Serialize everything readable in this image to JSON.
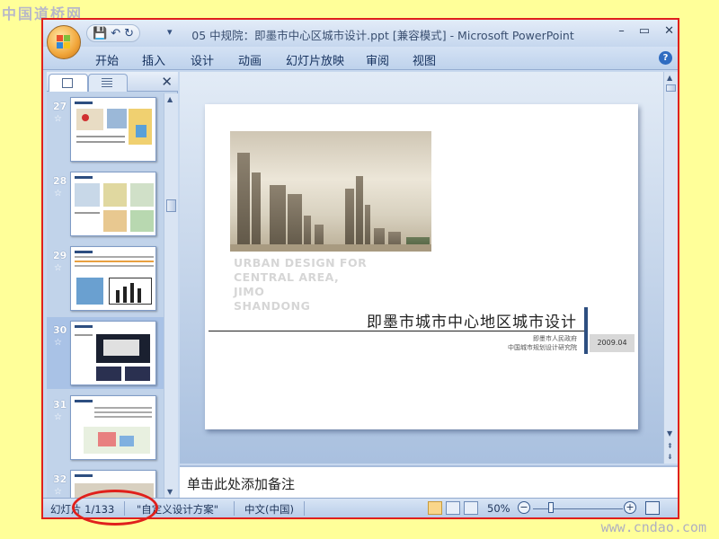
{
  "watermarks": {
    "top_left": "中国道桥网",
    "bottom_right": "www.cndao.com"
  },
  "window": {
    "title": "05 中规院：即墨市中心区城市设计.ppt [兼容模式] - Microsoft PowerPoint",
    "controls": [
      "–",
      "▭",
      "✕"
    ]
  },
  "quick_access": {
    "save": "💾",
    "undo": "↶",
    "redo": "↻",
    "more": "▾"
  },
  "ribbon": {
    "tabs": [
      "开始",
      "插入",
      "设计",
      "动画",
      "幻灯片放映",
      "审阅",
      "视图"
    ]
  },
  "thumbnails": [
    {
      "num": "27",
      "selected": false
    },
    {
      "num": "28",
      "selected": false
    },
    {
      "num": "29",
      "selected": false
    },
    {
      "num": "30",
      "selected": true
    },
    {
      "num": "31",
      "selected": false
    },
    {
      "num": "32",
      "selected": false
    }
  ],
  "slide": {
    "english_title": [
      "URBAN DESIGN FOR",
      "CENTRAL AREA,",
      "JIMO",
      "SHANDONG"
    ],
    "chinese_title": "即墨市城市中心地区城市设计",
    "org_line1": "即墨市人民政府",
    "org_line2": "中国城市规划设计研究院",
    "date": "2009.04"
  },
  "notes": {
    "placeholder": "单击此处添加备注"
  },
  "status": {
    "slide_info": "幻灯片 1/133",
    "theme": "\"自定义设计方案\"",
    "language": "中文(中国)",
    "zoom": "50%",
    "zoom_minus": "−",
    "zoom_plus": "+"
  },
  "colors": {
    "accent": "#2d4e80",
    "highlight_ring": "#e0201c",
    "background": "#ffff99"
  }
}
